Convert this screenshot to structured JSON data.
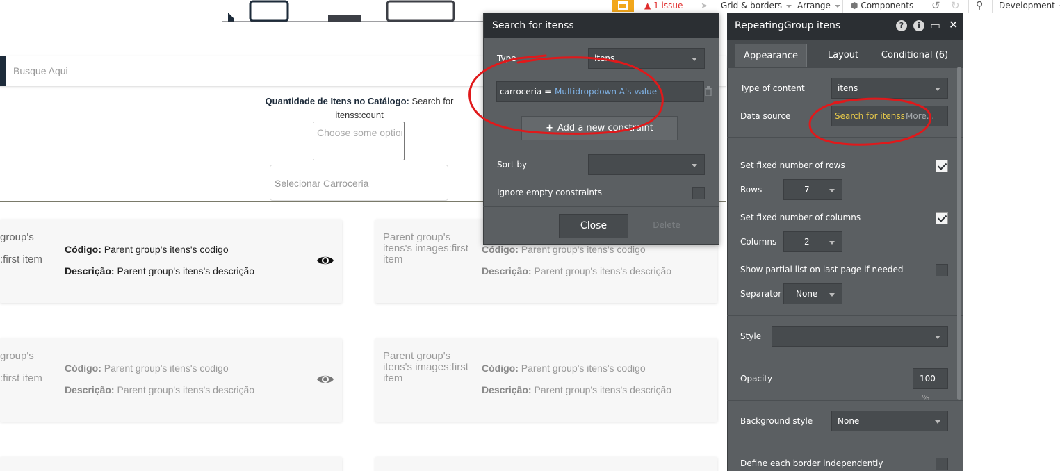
{
  "toolbar": {
    "issues": "1 issue",
    "grid_borders": "Grid & borders",
    "arrange": "Arrange",
    "components": "Components",
    "development": "Development"
  },
  "canvas": {
    "search_placeholder": "Busque Aqui",
    "qty_label": "Quantidade de Itens no Catálogo:",
    "qty_value": "Search for itenss:count",
    "multidropdown_placeholder": "Choose some options",
    "carroceria_placeholder": "Selecionar Carroceria",
    "cards": [
      {
        "image_alt": "group's\n\n:first item",
        "codigo_label": "Código:",
        "codigo_value": "Parent group's itens's codigo",
        "descricao_label": "Descrição:",
        "descricao_value": "Parent group's itens's descrição"
      },
      {
        "image_alt": "Parent group's itens's images:first item",
        "codigo_label": "Código:",
        "codigo_value": "Parent group's itens's codigo",
        "descricao_label": "Descrição:",
        "descricao_value": "Parent group's itens's descrição"
      },
      {
        "image_alt": "group's\n\n:first item",
        "codigo_label": "Código:",
        "codigo_value": "Parent group's itens's codigo",
        "descricao_label": "Descrição:",
        "descricao_value": "Parent group's itens's descrição"
      },
      {
        "image_alt": "Parent group's itens's images:first item",
        "codigo_label": "Código:",
        "codigo_value": "Parent group's itens's codigo",
        "descricao_label": "Descrição:",
        "descricao_value": "Parent group's itens's descrição"
      }
    ]
  },
  "search_popup": {
    "title": "Search for itenss",
    "type_label": "Type",
    "type_value": "itens",
    "constraint_key": "carroceria =",
    "constraint_value": "Multidropdown A's value",
    "add_constraint": "Add a new constraint",
    "sort_by_label": "Sort by",
    "sort_by_value": "",
    "ignore_empty_label": "Ignore empty constraints",
    "close_label": "Close",
    "delete_label": "Delete"
  },
  "property_editor": {
    "title": "RepeatingGroup itens",
    "tabs": [
      {
        "label": "Appearance",
        "active": true
      },
      {
        "label": "Layout",
        "active": false
      },
      {
        "label": "Conditional (6)",
        "active": false
      }
    ],
    "type_of_content_label": "Type of content",
    "type_of_content_value": "itens",
    "data_source_label": "Data source",
    "data_source_value": "Search for itenss",
    "data_source_more": "More...",
    "fixed_rows_label": "Set fixed number of rows",
    "fixed_rows_checked": true,
    "rows_label": "Rows",
    "rows_value": "7",
    "fixed_cols_label": "Set fixed number of columns",
    "fixed_cols_checked": true,
    "columns_label": "Columns",
    "columns_value": "2",
    "partial_list_label": "Show partial list on last page if needed",
    "partial_list_checked": false,
    "separator_label": "Separator",
    "separator_value": "None",
    "style_label": "Style",
    "style_value": "",
    "opacity_label": "Opacity",
    "opacity_value": "100",
    "opacity_unit": "%",
    "bg_style_label": "Background style",
    "bg_style_value": "None",
    "border_label": "Define each border independently",
    "border_checked": false
  },
  "colors": {
    "panel_bg": "#5b5f62",
    "panel_header": "#2b2f33",
    "annotation_red": "#e0191b",
    "data_source_yellow": "#e6c84a",
    "dynamic_value_blue": "#7fb2e5"
  }
}
